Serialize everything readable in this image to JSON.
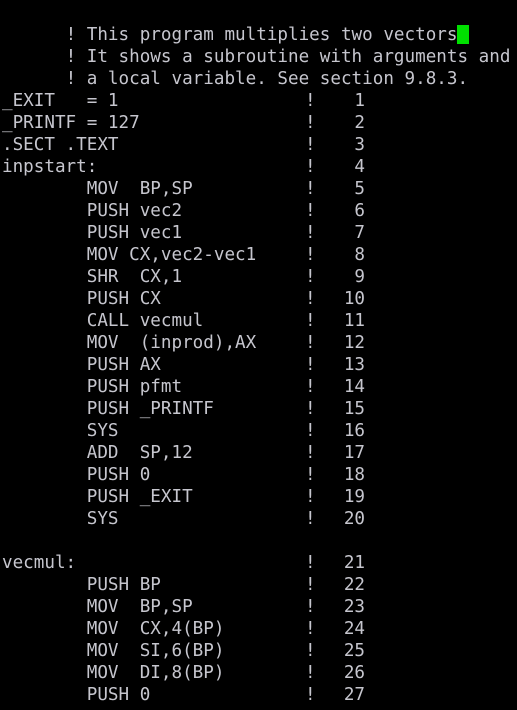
{
  "terminal": {
    "title": "assembly source listing",
    "background_color": "#000000",
    "text_color": "#c6c6ce",
    "cursor_color": "#00e000",
    "cursor_glyph": "block-cursor",
    "comment_marker": "!",
    "columns": 42,
    "rows": 32
  },
  "header": {
    "lines": [
      "! This program multiplies two vectors",
      "! It shows a subroutine with arguments and",
      "! a local variable. See section 9.8.3."
    ],
    "cursor_after_line_index": 0
  },
  "listing": {
    "bang": "!",
    "rows": [
      {
        "code": "_EXIT   = 1",
        "num": "1"
      },
      {
        "code": "_PRINTF = 127",
        "num": "2"
      },
      {
        "code": ".SECT .TEXT",
        "num": "3"
      },
      {
        "code": "inpstart:",
        "num": "4"
      },
      {
        "code": "        MOV  BP,SP",
        "num": "5"
      },
      {
        "code": "        PUSH vec2",
        "num": "6"
      },
      {
        "code": "        PUSH vec1",
        "num": "7"
      },
      {
        "code": "        MOV CX,vec2-vec1",
        "num": "8"
      },
      {
        "code": "        SHR  CX,1",
        "num": "9"
      },
      {
        "code": "        PUSH CX",
        "num": "10"
      },
      {
        "code": "        CALL vecmul",
        "num": "11"
      },
      {
        "code": "        MOV  (inprod),AX",
        "num": "12"
      },
      {
        "code": "        PUSH AX",
        "num": "13"
      },
      {
        "code": "        PUSH pfmt",
        "num": "14"
      },
      {
        "code": "        PUSH _PRINTF",
        "num": "15"
      },
      {
        "code": "        SYS",
        "num": "16"
      },
      {
        "code": "        ADD  SP,12",
        "num": "17"
      },
      {
        "code": "        PUSH 0",
        "num": "18"
      },
      {
        "code": "        PUSH _EXIT",
        "num": "19"
      },
      {
        "code": "        SYS",
        "num": "20"
      },
      {
        "code": "",
        "num": ""
      },
      {
        "code": "vecmul:",
        "num": "21"
      },
      {
        "code": "        PUSH BP",
        "num": "22"
      },
      {
        "code": "        MOV  BP,SP",
        "num": "23"
      },
      {
        "code": "        MOV  CX,4(BP)",
        "num": "24"
      },
      {
        "code": "        MOV  SI,6(BP)",
        "num": "25"
      },
      {
        "code": "        MOV  DI,8(BP)",
        "num": "26"
      },
      {
        "code": "        PUSH 0",
        "num": "27"
      }
    ]
  }
}
